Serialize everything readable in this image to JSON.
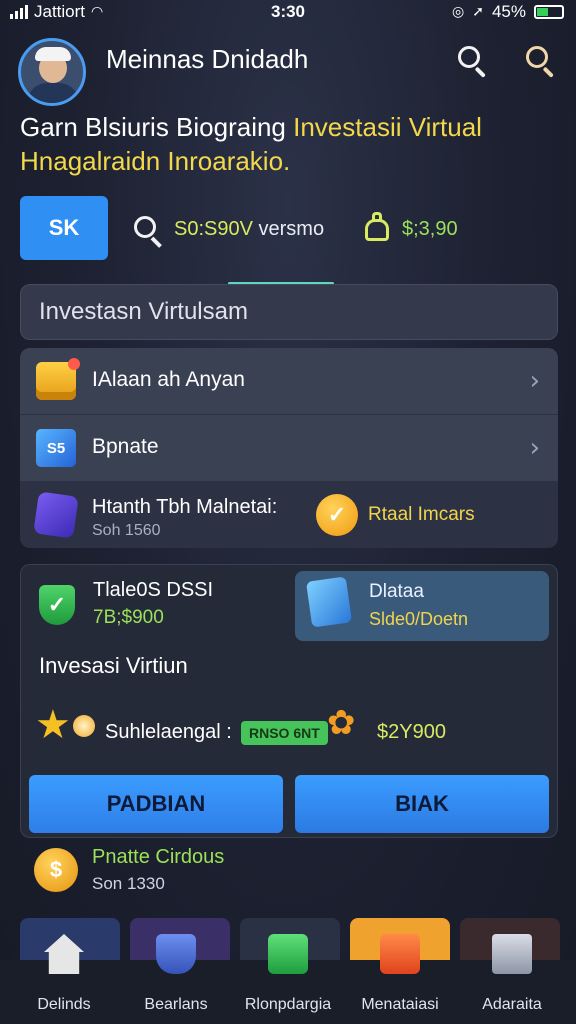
{
  "status_bar": {
    "carrier": "Jattiort",
    "time": "3:30",
    "battery": "45%"
  },
  "header": {
    "username": "Meinnas Dnidadh"
  },
  "headline": {
    "part1": "Garn Blsiuris  Biograing ",
    "part2_highlight": "Investasii Virtual",
    "line2_highlight": "Hnagalraidn Inroarakio."
  },
  "toolbar": {
    "btn_label": "SK",
    "stat_value": "S0:S90V",
    "stat_suffix": " versmo",
    "amount": "$;3,90"
  },
  "search": {
    "placeholder": "Investasn Virtulsam"
  },
  "menu": {
    "items": [
      {
        "label": "IAlaan ah Anyan"
      },
      {
        "label": "Bpnate",
        "icon_text": "S5"
      }
    ],
    "row3": {
      "title": "Htanth Tbh Malnetai:",
      "subtitle": "Soh 1560",
      "right_label": "Rtaal Imcars"
    }
  },
  "investment": {
    "title": "Tlale0S DSSI",
    "value": "7B;$900",
    "side_tile": {
      "line1": "Dlataa",
      "line2": "Slde0/Doetn"
    },
    "heading": "Invesasi Virtiun",
    "stat_label": "Suhlelaengal :",
    "pill": "RNSO 6NT",
    "amount": "$2Y900",
    "primary_button": "PADBIAN",
    "secondary_button": "BIAK"
  },
  "promo": {
    "title": "Pnatte  Cirdous",
    "subtitle": "Son 1330"
  },
  "bottom_nav": [
    {
      "label": "Delinds"
    },
    {
      "label": "Bearlans"
    },
    {
      "label": "Rlonpdargia"
    },
    {
      "label": "Menataiasi"
    },
    {
      "label": "Adaraita"
    }
  ]
}
